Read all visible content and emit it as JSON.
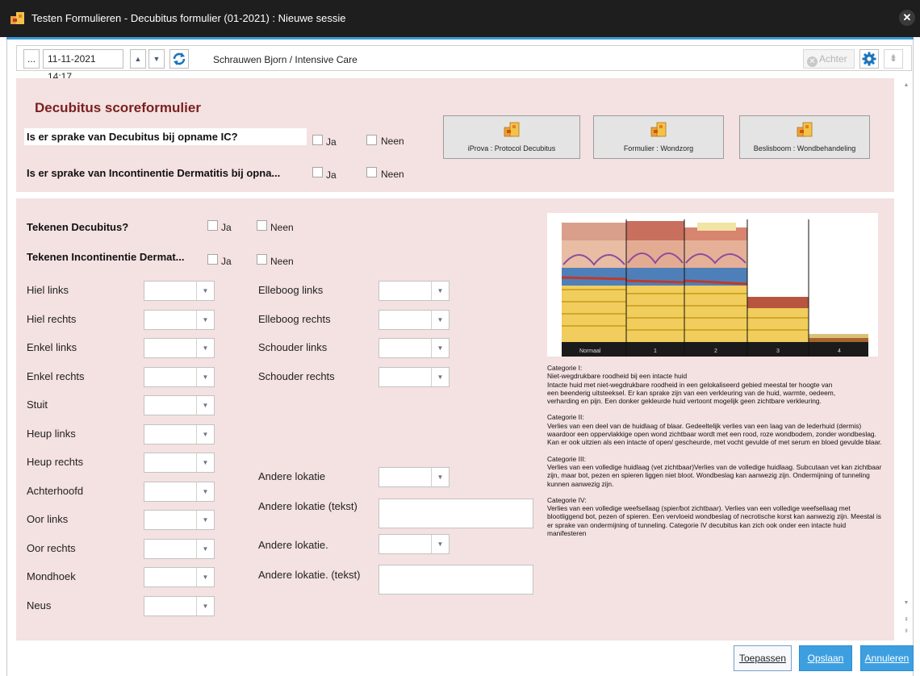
{
  "window": {
    "title": "Testen Formulieren - Decubitus formulier (01-2021) : Nieuwe sessie",
    "close_glyph": "✕"
  },
  "toolbar": {
    "ellipsis": "...",
    "datetime": "11-11-2021 14:17",
    "up_glyph": "▲",
    "down_glyph": "▼",
    "patient": "Schrauwen Bjorn / Intensive Care",
    "back_label": "Achter",
    "back_x": "✕",
    "download_glyph": "⇟"
  },
  "top": {
    "title": "Decubitus scoreformulier",
    "q1": "Is er sprake van Decubitus bij opname IC?",
    "q2": "Is er sprake van Incontinentie Dermatitis bij opna...",
    "yes": "Ja",
    "no": "Neen",
    "buttons": [
      {
        "label": "iProva : Protocol Decubitus",
        "icon": "puzzle-icon"
      },
      {
        "label": "Formulier : Wondzorg",
        "icon": "puzzle-icon"
      },
      {
        "label": "Beslisboom : Wondbehandeling",
        "icon": "puzzle-icon"
      }
    ]
  },
  "main": {
    "q_signs": "Tekenen Decubitus?",
    "q_signs_ind": "Tekenen Incontinentie Dermat...",
    "yes": "Ja",
    "no": "Neen",
    "dropdown_arrow": "▼",
    "left_fields": [
      "Hiel links",
      "Hiel rechts",
      "Enkel links",
      "Enkel rechts",
      "Stuit",
      "Heup links",
      "Heup rechts",
      "Achterhoofd",
      "Oor links",
      "Oor rechts",
      "Mondhoek",
      "Neus"
    ],
    "right_fields": [
      "Elleboog links",
      "Elleboog rechts",
      "Schouder links",
      "Schouder rechts"
    ],
    "other": {
      "loc1": "Andere lokatie",
      "loc1_text": "Andere lokatie (tekst)",
      "loc2": "Andere lokatie.",
      "loc2_text": "Andere lokatie. (tekst)"
    },
    "image_labels": [
      "Normaal",
      "1",
      "2",
      "3",
      "4"
    ],
    "categories": [
      "Categorie I:\nNiet-wegdrukbare roodheid bij een intacte huid\nIntacte huid met niet-wegdrukbare roodheid in een gelokaliseerd gebied meestal ter hoogte van\neen beenderig uitsteeksel. Er kan sprake zijn van een verkleuring van de huid, warmte, oedeem,\nverharding en pijn. Een donker gekleurde huid vertoont mogelijk geen zichtbare verkleuring.",
      "Categorie II:\nVerlies van een deel van de huidlaag of blaar. Gedeeltelijk verlies van een laag van de lederhuid (dermis) waardoor een oppervlakkige open wond zichtbaar wordt met een rood, roze wondbodem, zonder wondbeslag. Kan er ook uitzien als een intacte of open/ gescheurde, met vocht gevulde of met serum en bloed gevulde blaar.",
      "Categorie III:\nVerlies van een volledige huidlaag (vet zichtbaar)Verlies van de volledige huidlaag. Subcutaan vet kan zichtbaar zijn, maar bot, pezen en spieren liggen niet bloot. Wondbeslag kan aanwezig zijn. Ondermijning of tunneling kunnen aanwezig zijn.",
      "Categorie IV:\nVerlies van een volledige weefsellaag (spier/bot zichtbaar). Verlies van een volledige weefsellaag met blootliggend bot, pezen of spieren. Een vervloeid wondbeslag of necrotische korst kan aanwezig zijn. Meestal is er sprake van ondermijning of tunneling. Categorie IV decubitus kan zich ook onder een intacte huid manifesteren"
    ]
  },
  "footer": {
    "apply": "Toepassen",
    "save": "Opslaan",
    "cancel": "Annuleren"
  },
  "colors": {
    "panel": "#f4e1e1",
    "accent": "#3d9bd6",
    "heading": "#7a1f1f"
  }
}
